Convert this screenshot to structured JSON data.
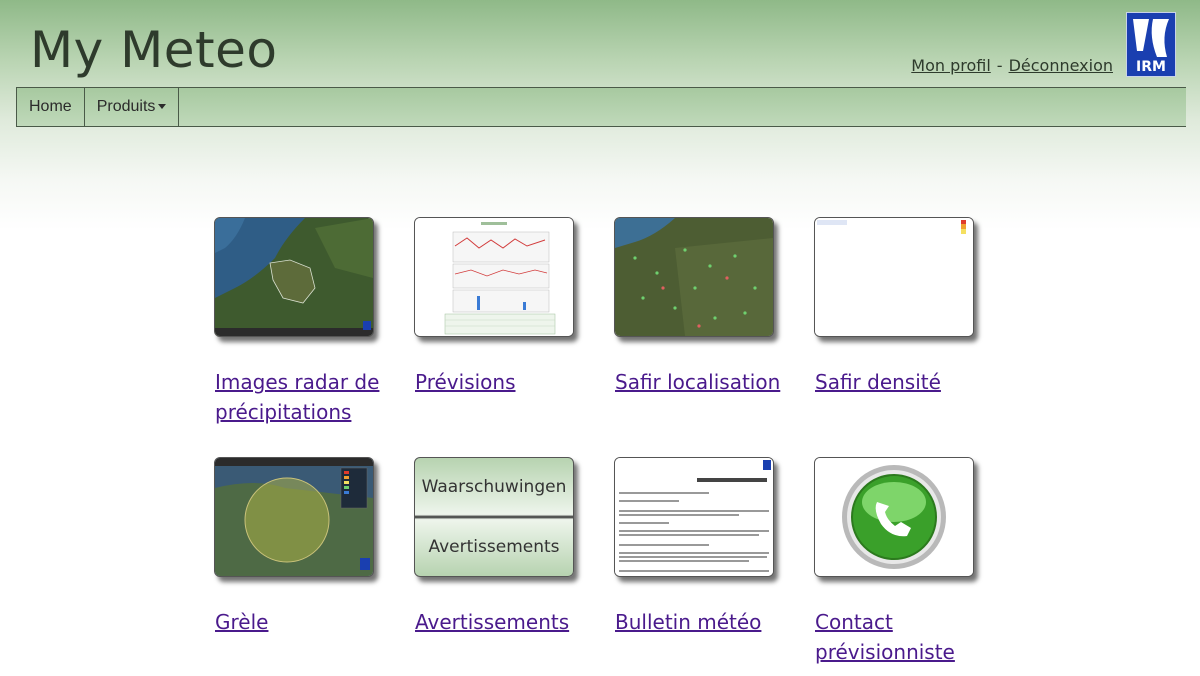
{
  "app": {
    "title": "My Meteo",
    "logo_text": "IRM"
  },
  "user_links": {
    "profile": "Mon profil",
    "separator": "-",
    "logout": "Déconnexion"
  },
  "nav": {
    "home": "Home",
    "products": "Produits"
  },
  "tiles": [
    {
      "label": "Images radar de précipitations",
      "icon": "radar-map-thumbnail"
    },
    {
      "label": "Prévisions",
      "icon": "forecast-chart-thumbnail"
    },
    {
      "label": "Safir localisation",
      "icon": "lightning-map-thumbnail"
    },
    {
      "label": "Safir densité",
      "icon": "density-map-thumbnail"
    },
    {
      "label": "Grèle",
      "icon": "hail-map-thumbnail"
    },
    {
      "label": "Avertissements",
      "icon": "warnings-thumbnail",
      "thumb_top": "Waarschuwingen",
      "thumb_bottom": "Avertissements"
    },
    {
      "label": "Bulletin météo",
      "icon": "bulletin-document-thumbnail"
    },
    {
      "label": "Contact prévisionniste",
      "icon": "phone-icon"
    }
  ],
  "colors": {
    "header_green": "#8fb988",
    "link": "#4a1a8c",
    "logo_blue": "#1a3fb0"
  }
}
